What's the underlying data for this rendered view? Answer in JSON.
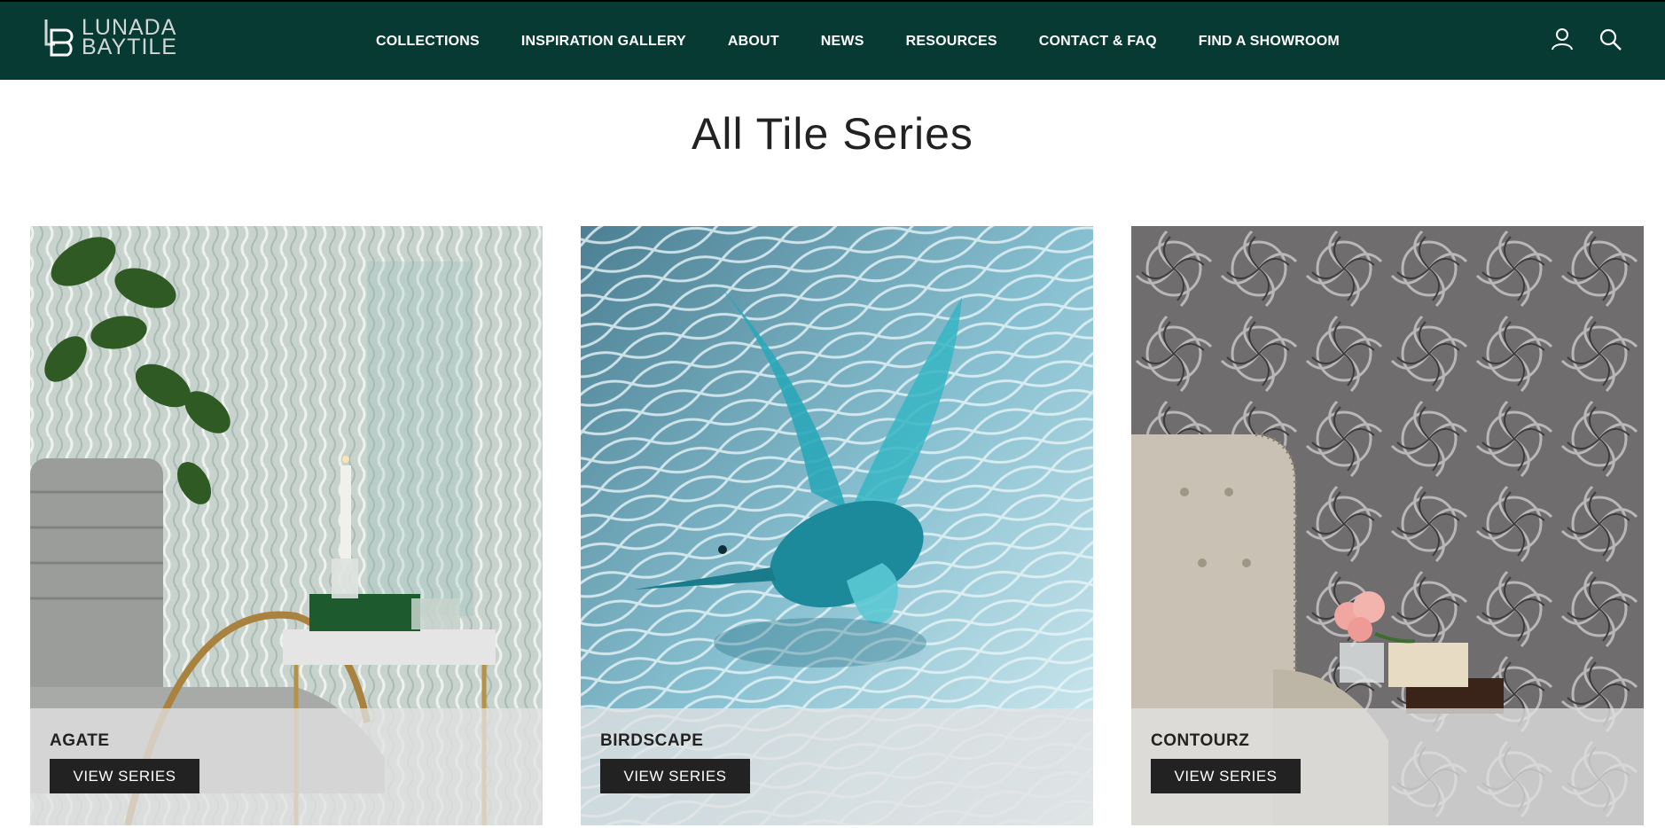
{
  "brand": {
    "line1": "LUNADA",
    "line2": "BAYTILE",
    "color": "#063a33"
  },
  "nav": {
    "items": [
      {
        "label": "COLLECTIONS"
      },
      {
        "label": "INSPIRATION GALLERY"
      },
      {
        "label": "ABOUT"
      },
      {
        "label": "NEWS"
      },
      {
        "label": "RESOURCES"
      },
      {
        "label": "CONTACT & FAQ"
      },
      {
        "label": "FIND A SHOWROOM"
      }
    ]
  },
  "header_icons": [
    "account-icon",
    "search-icon"
  ],
  "page": {
    "title": "All Tile Series"
  },
  "series": [
    {
      "name": "AGATE",
      "button": "VIEW SERIES"
    },
    {
      "name": "BIRDSCAPE",
      "button": "VIEW SERIES"
    },
    {
      "name": "CONTOURZ",
      "button": "VIEW SERIES"
    }
  ]
}
